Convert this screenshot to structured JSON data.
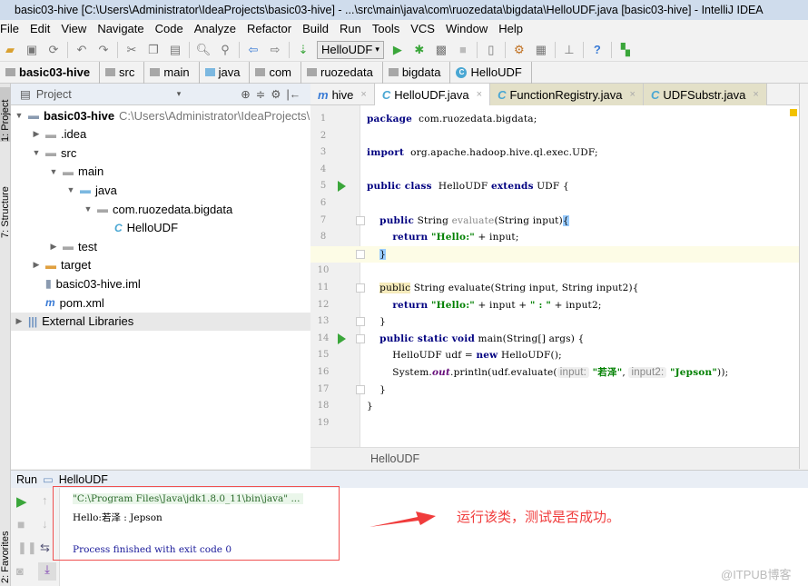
{
  "window": {
    "title": "basic03-hive [C:\\Users\\Administrator\\IdeaProjects\\basic03-hive] - ...\\src\\main\\java\\com\\ruozedata\\bigdata\\HelloUDF.java [basic03-hive] - IntelliJ IDEA"
  },
  "menu": [
    "File",
    "Edit",
    "View",
    "Navigate",
    "Code",
    "Analyze",
    "Refactor",
    "Build",
    "Run",
    "Tools",
    "VCS",
    "Window",
    "Help"
  ],
  "toolbar": {
    "run_config": "HelloUDF"
  },
  "breadcrumb": [
    "basic03-hive",
    "src",
    "main",
    "java",
    "com",
    "ruozedata",
    "bigdata",
    "HelloUDF"
  ],
  "left_tabs": [
    "1: Project",
    "7: Structure",
    "2: Favorites"
  ],
  "project": {
    "header": "Project",
    "tree": [
      {
        "label": "basic03-hive",
        "path": "C:\\Users\\Administrator\\IdeaProjects\\",
        "level": 0,
        "expanded": true,
        "icon": "module-folder-icon"
      },
      {
        "label": ".idea",
        "level": 1,
        "expanded": false,
        "icon": "folder-icon"
      },
      {
        "label": "src",
        "level": 1,
        "expanded": true,
        "icon": "folder-icon"
      },
      {
        "label": "main",
        "level": 2,
        "expanded": true,
        "icon": "folder-icon"
      },
      {
        "label": "java",
        "level": 3,
        "expanded": true,
        "icon": "source-folder-icon"
      },
      {
        "label": "com.ruozedata.bigdata",
        "level": 4,
        "expanded": true,
        "icon": "package-icon"
      },
      {
        "label": "HelloUDF",
        "level": 5,
        "icon": "class-icon"
      },
      {
        "label": "test",
        "level": 2,
        "expanded": false,
        "icon": "folder-icon"
      },
      {
        "label": "target",
        "level": 1,
        "expanded": false,
        "icon": "excluded-folder-icon"
      },
      {
        "label": "basic03-hive.iml",
        "level": 1,
        "icon": "iml-file-icon"
      },
      {
        "label": "pom.xml",
        "level": 1,
        "icon": "maven-icon"
      },
      {
        "label": "External Libraries",
        "level": 0,
        "expanded": false,
        "icon": "libraries-icon",
        "selected": true
      }
    ]
  },
  "tabs": [
    {
      "label": "hive",
      "icon": "maven-icon"
    },
    {
      "label": "HelloUDF.java",
      "active": true,
      "icon": "class-icon"
    },
    {
      "label": "FunctionRegistry.java",
      "icon": "class-locked-icon"
    },
    {
      "label": "UDFSubstr.java",
      "icon": "class-locked-icon"
    }
  ],
  "editor": {
    "footer": "HelloUDF",
    "current_line": 9,
    "lines": [
      [
        [
          "kw",
          "package"
        ],
        [
          "",
          "  com.ruozedata.bigdata;"
        ]
      ],
      [],
      [
        [
          "kw",
          "import"
        ],
        [
          "",
          "  org.apache.hadoop.hive.ql.exec.UDF;"
        ]
      ],
      [],
      [
        [
          "kw",
          "public class"
        ],
        [
          "",
          "  HelloUDF "
        ],
        [
          "kw",
          "extends"
        ],
        [
          "",
          " UDF {"
        ]
      ],
      [],
      [
        [
          "",
          "    "
        ],
        [
          "kw",
          "public"
        ],
        [
          "",
          " String "
        ],
        [
          "dim",
          "evaluate"
        ],
        [
          "",
          "(String input)"
        ],
        [
          "brk",
          "{"
        ]
      ],
      [
        [
          "",
          "        "
        ],
        [
          "kw",
          "return"
        ],
        [
          "",
          " "
        ],
        [
          "str",
          "\"Hello:\""
        ],
        [
          "",
          " + input;"
        ]
      ],
      [
        [
          "",
          "    "
        ],
        [
          "brk",
          "}"
        ]
      ],
      [],
      [
        [
          "",
          "    "
        ],
        [
          "pubhl",
          "public"
        ],
        [
          "",
          " String evaluate(String input, String input2){"
        ]
      ],
      [
        [
          "",
          "        "
        ],
        [
          "kw",
          "return"
        ],
        [
          "",
          " "
        ],
        [
          "str",
          "\"Hello:\""
        ],
        [
          "",
          " + input + "
        ],
        [
          "str",
          "\" : \""
        ],
        [
          "",
          " + input2;"
        ]
      ],
      [
        [
          "",
          "    }"
        ]
      ],
      [
        [
          "",
          "    "
        ],
        [
          "kw",
          "public static void"
        ],
        [
          "",
          " main(String[] args) {"
        ]
      ],
      [
        [
          "",
          "        HelloUDF udf = "
        ],
        [
          "kw",
          "new"
        ],
        [
          "",
          " HelloUDF();"
        ]
      ],
      [
        [
          "",
          "        System."
        ],
        [
          "fld2",
          "out"
        ],
        [
          "",
          ".println(udf.evaluate("
        ],
        [
          "hint",
          "input:"
        ],
        [
          "",
          " "
        ],
        [
          "str",
          "\"若泽\""
        ],
        [
          "",
          ", "
        ],
        [
          "hint",
          "input2:"
        ],
        [
          "",
          " "
        ],
        [
          "str",
          "\"Jepson\""
        ],
        [
          "",
          "));"
        ]
      ],
      [
        [
          "",
          "    }"
        ]
      ],
      [
        [
          "",
          "}"
        ]
      ],
      []
    ],
    "run_gutter_lines": [
      5,
      14
    ]
  },
  "run": {
    "label": "Run",
    "config": "HelloUDF",
    "output": [
      "\"C:\\Program Files\\Java\\jdk1.8.0_11\\bin\\java\" ...",
      "Hello:若泽 : Jepson",
      "",
      "Process finished with exit code 0"
    ]
  },
  "annotation": "运行该类，测试是否成功。",
  "watermark": "@ITPUB博客",
  "colors": {
    "keyword": "#000080",
    "string": "#008000",
    "annotation": "#f03c3c",
    "run_green": "#3aa63a"
  }
}
